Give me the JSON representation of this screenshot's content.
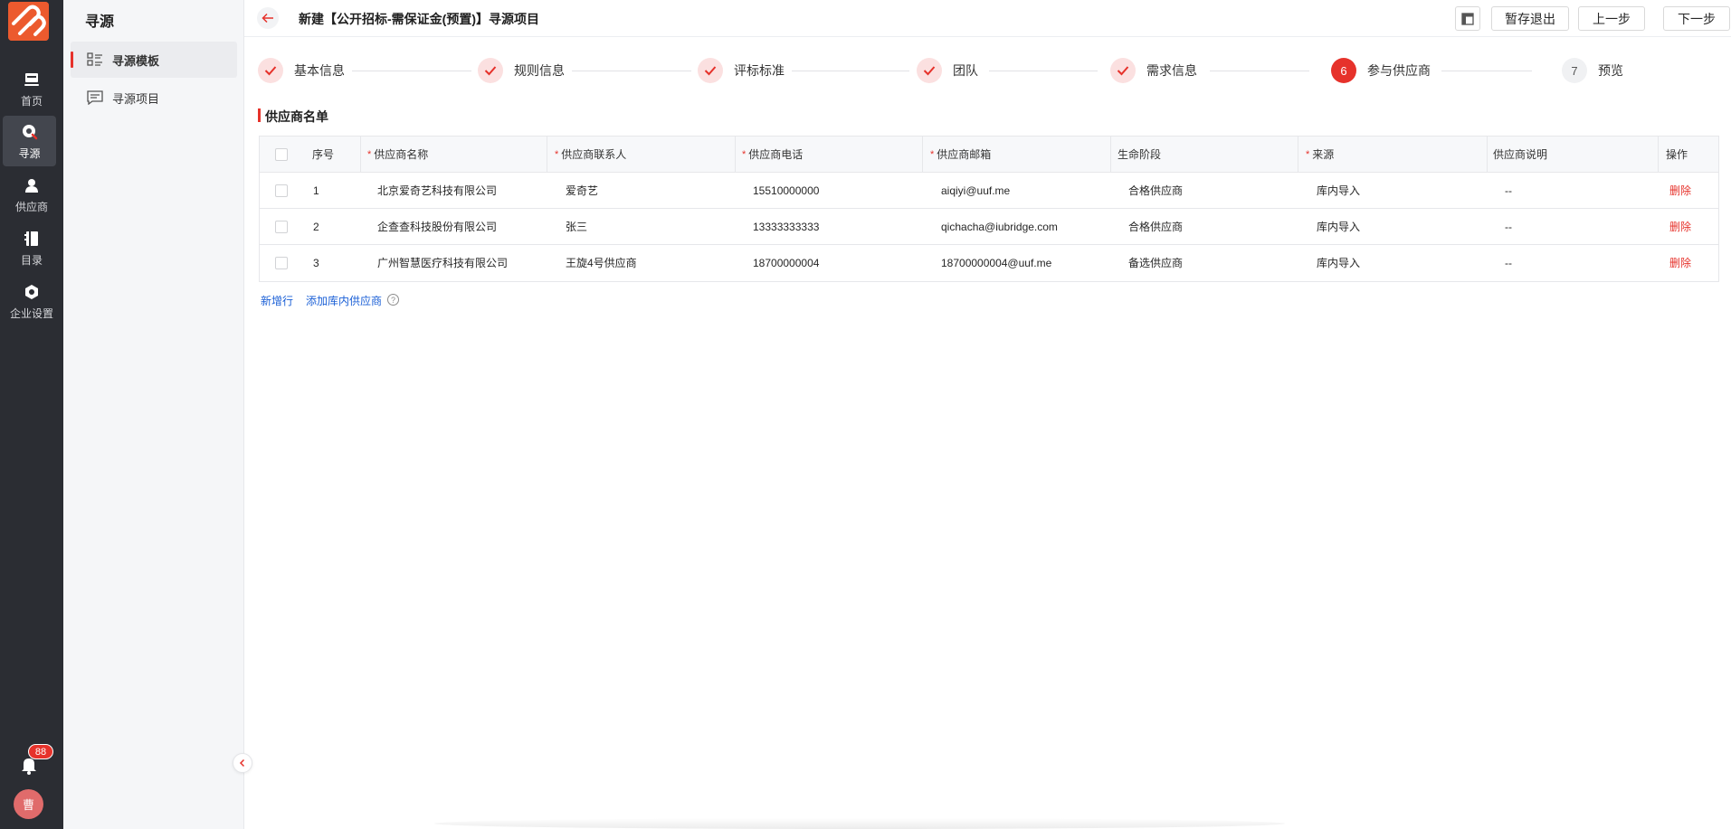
{
  "rail": {
    "items": [
      {
        "label": "首页",
        "icon": "home-icon"
      },
      {
        "label": "寻源",
        "icon": "sourcing-icon"
      },
      {
        "label": "供应商",
        "icon": "supplier-icon"
      },
      {
        "label": "目录",
        "icon": "catalog-icon"
      },
      {
        "label": "企业设置",
        "icon": "settings-icon"
      }
    ],
    "active_index": 1,
    "notification_count": "88",
    "avatar_text": "曹"
  },
  "sidebar": {
    "title": "寻源",
    "items": [
      {
        "label": "寻源模板",
        "icon": "template-list-icon",
        "active": true
      },
      {
        "label": "寻源项目",
        "icon": "project-message-icon",
        "active": false
      }
    ]
  },
  "header": {
    "title": "新建【公开招标-需保证金(预置)】寻源项目",
    "buttons": {
      "save_exit": "暂存退出",
      "prev": "上一步",
      "next": "下一步"
    }
  },
  "steps": [
    {
      "label": "基本信息",
      "state": "done"
    },
    {
      "label": "规则信息",
      "state": "done"
    },
    {
      "label": "评标标准",
      "state": "done"
    },
    {
      "label": "团队",
      "state": "done"
    },
    {
      "label": "需求信息",
      "state": "done"
    },
    {
      "label": "参与供应商",
      "state": "current",
      "number": "6"
    },
    {
      "label": "预览",
      "state": "todo",
      "number": "7"
    }
  ],
  "section": {
    "title": "供应商名单"
  },
  "table": {
    "columns": [
      {
        "label": "序号",
        "required": false
      },
      {
        "label": "供应商名称",
        "required": true
      },
      {
        "label": "供应商联系人",
        "required": true
      },
      {
        "label": "供应商电话",
        "required": true
      },
      {
        "label": "供应商邮箱",
        "required": true
      },
      {
        "label": "生命阶段",
        "required": false
      },
      {
        "label": "来源",
        "required": true
      },
      {
        "label": "供应商说明",
        "required": false
      },
      {
        "label": "操作",
        "required": false
      }
    ],
    "rows": [
      {
        "index": "1",
        "name": "北京爱奇艺科技有限公司",
        "contact": "爱奇艺",
        "phone": "15510000000",
        "email": "aiqiyi@uuf.me",
        "stage": "合格供应商",
        "source": "库内导入",
        "note": "--",
        "action": "删除"
      },
      {
        "index": "2",
        "name": "企查查科技股份有限公司",
        "contact": "张三",
        "phone": "13333333333",
        "email": "qichacha@iubridge.com",
        "stage": "合格供应商",
        "source": "库内导入",
        "note": "--",
        "action": "删除"
      },
      {
        "index": "3",
        "name": "广州智慧医疗科技有限公司",
        "contact": "王旋4号供应商",
        "phone": "18700000004",
        "email": "18700000004@uuf.me",
        "stage": "备选供应商",
        "source": "库内导入",
        "note": "--",
        "action": "删除"
      }
    ]
  },
  "actions": {
    "add_row": "新增行",
    "add_from_library": "添加库内供应商",
    "help": "?"
  },
  "colors": {
    "accent": "#e6322b",
    "link": "#1a5fd6",
    "rail_bg": "#2b2d33"
  }
}
